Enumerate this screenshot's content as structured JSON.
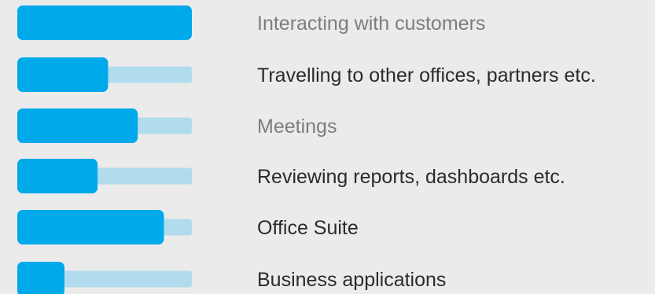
{
  "colors": {
    "background": "#ebebeb",
    "bar_fill": "#00a9ea",
    "bar_track": "#b1dced",
    "label_active": "#2b2b2b",
    "label_muted": "#7d7d7d"
  },
  "chart_data": {
    "type": "bar",
    "orientation": "horizontal",
    "title": "",
    "xlabel": "",
    "ylabel": "",
    "xlim": [
      0,
      1
    ],
    "grid": false,
    "legend": "none",
    "categories": [
      "Interacting with customers",
      "Travelling to other offices, partners etc.",
      "Meetings",
      "Reviewing reports, dashboards etc.",
      "Office Suite",
      "Business applications"
    ],
    "values": [
      1.0,
      0.52,
      0.69,
      0.46,
      0.84,
      0.27
    ],
    "label_emphasis": [
      "muted",
      "active",
      "muted",
      "active",
      "active",
      "active"
    ]
  }
}
